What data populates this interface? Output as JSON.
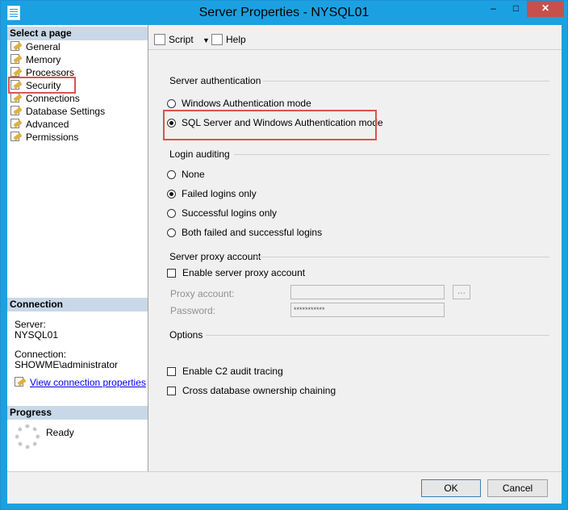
{
  "window": {
    "title": "Server Properties - NYSQL01",
    "minimize": "–",
    "maximize": "□",
    "close": "✕"
  },
  "left_pane": {
    "header": "Select a page",
    "pages": [
      {
        "label": "General"
      },
      {
        "label": "Memory"
      },
      {
        "label": "Processors"
      },
      {
        "label": "Security"
      },
      {
        "label": "Connections"
      },
      {
        "label": "Database Settings"
      },
      {
        "label": "Advanced"
      },
      {
        "label": "Permissions"
      }
    ],
    "connection_header": "Connection",
    "server_label": "Server:",
    "server_value": "NYSQL01",
    "connection_label": "Connection:",
    "connection_value": "SHOWME\\administrator",
    "view_link": "View connection properties",
    "progress_header": "Progress",
    "progress_status": "Ready"
  },
  "toolbar": {
    "script_label": "Script",
    "help_label": "Help"
  },
  "security": {
    "server_auth_header": "Server authentication",
    "windows_auth": "Windows Authentication mode",
    "mixed_auth": "SQL Server and Windows Authentication mode",
    "login_auditing_header": "Login auditing",
    "audit_none": "None",
    "audit_failed": "Failed logins only",
    "audit_success": "Successful logins only",
    "audit_both": "Both failed and successful logins",
    "proxy_header": "Server proxy account",
    "proxy_enable": "Enable server proxy account",
    "proxy_account_label": "Proxy account:",
    "password_label": "Password:",
    "password_value": "***********",
    "ellipsis": "...",
    "options_header": "Options",
    "c2_audit": "Enable C2 audit tracing",
    "cross_db": "Cross database ownership chaining"
  },
  "buttons": {
    "ok": "OK",
    "cancel": "Cancel"
  }
}
